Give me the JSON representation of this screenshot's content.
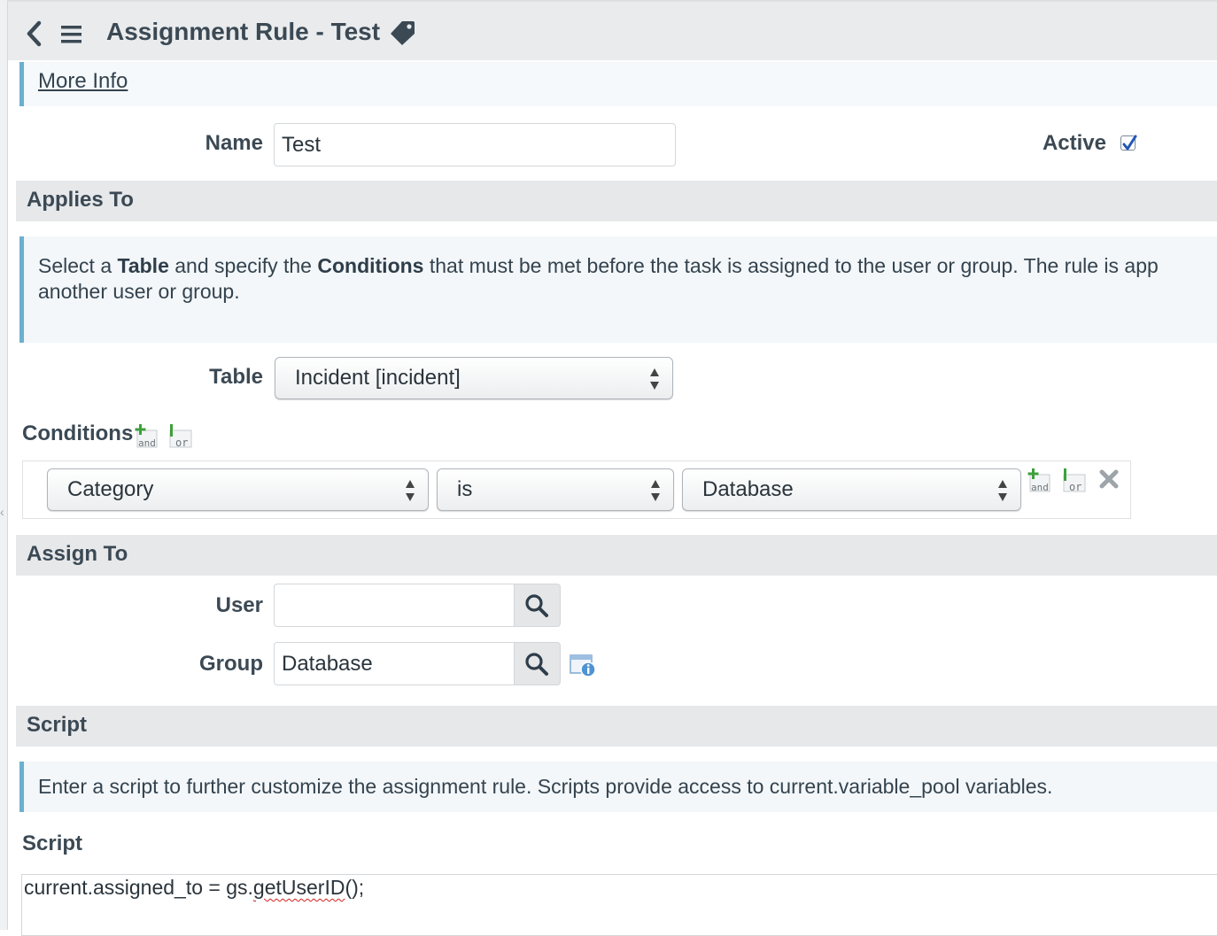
{
  "header": {
    "title": "Assignment Rule - Test"
  },
  "more_info": {
    "link_label": "More Info"
  },
  "form": {
    "name_label": "Name",
    "name_value": "Test",
    "active_label": "Active",
    "active_checked": true
  },
  "applies_to": {
    "section_title": "Applies To",
    "info": {
      "part1": "Select a ",
      "bold1": "Table",
      "part2": " and specify the ",
      "bold2": "Conditions",
      "part3": " that must be met before the task is assigned to the user or group. The rule is app",
      "line2": "another user or group."
    },
    "table_label": "Table",
    "table_value": "Incident [incident]",
    "conditions_label": "Conditions",
    "condition": {
      "field": "Category",
      "operator": "is",
      "value": "Database"
    }
  },
  "assign_to": {
    "section_title": "Assign To",
    "user_label": "User",
    "user_value": "",
    "group_label": "Group",
    "group_value": "Database"
  },
  "script": {
    "section_title": "Script",
    "info": "Enter a script to further customize the assignment rule. Scripts provide access to current.variable_pool variables.",
    "field_label": "Script",
    "code_before": "current.assigned_to = gs.",
    "code_squiggle": "getUserID",
    "code_after": "();"
  },
  "icons": {
    "back": "chevron-left-icon",
    "menu": "hamburger-menu-icon",
    "tag": "tag-icon",
    "search": "search-icon",
    "add_and": "add-and-condition-icon",
    "add_or": "add-or-condition-icon",
    "delete": "delete-condition-icon",
    "reference_info": "reference-info-icon"
  },
  "colors": {
    "accent_bar": "#6bb0ce",
    "header_bg": "#e9ebed",
    "section_bg": "#e6e8ea",
    "checkbox_mark": "#1f57b8"
  }
}
